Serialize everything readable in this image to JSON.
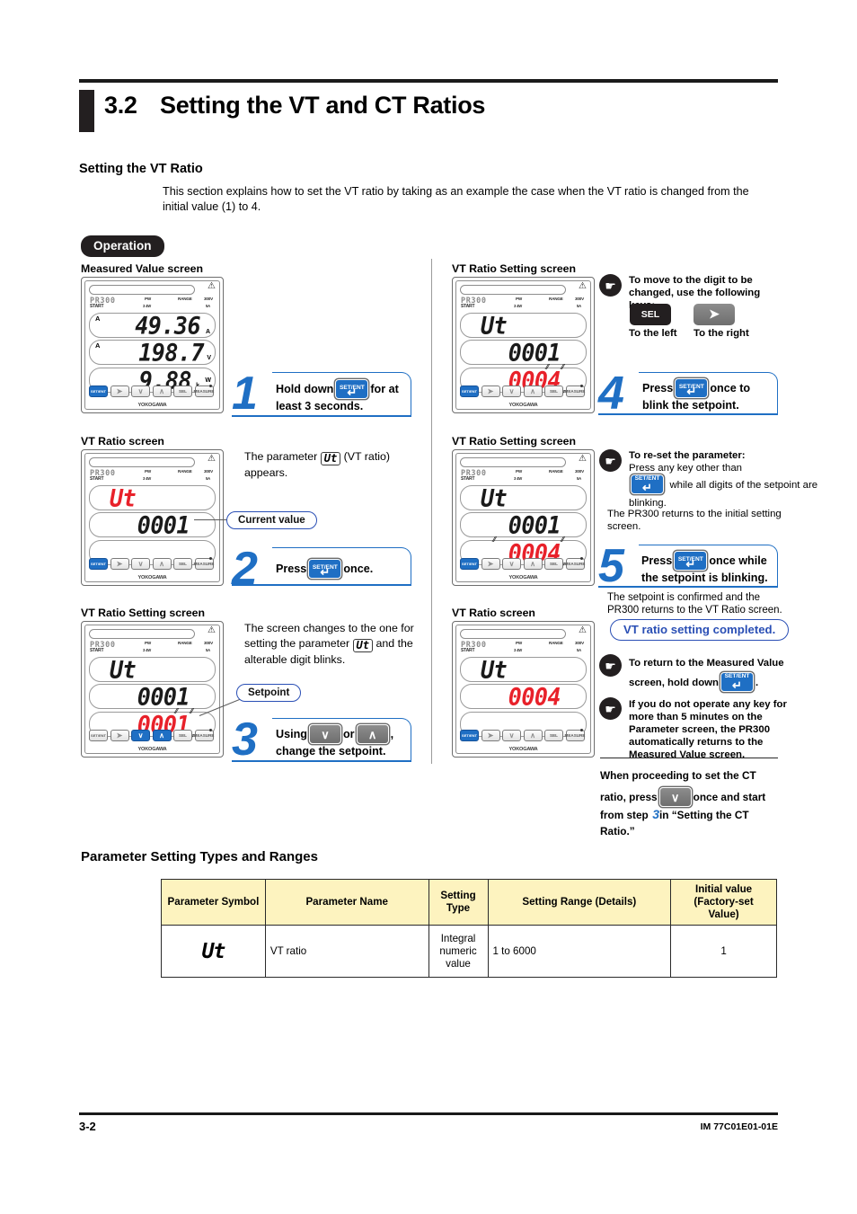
{
  "header": {
    "section_number": "3.2",
    "section_title": "Setting the VT and CT Ratios",
    "subsection_title": "Setting the VT Ratio",
    "intro": "This section explains how to set the VT ratio by taking as an example the case when the VT ratio is changed from the initial value (1) to 4."
  },
  "operation_badge": "Operation",
  "device": {
    "brand": "PR300",
    "yokogawa": "YOKOGAWA",
    "start_label": "START",
    "indicators": {
      "pw": "PW",
      "phase": "3 4W",
      "range": "RANGE",
      "volt": "300V",
      "amp": "5A"
    },
    "keys": {
      "setent": "SET/ENT",
      "right": "▶",
      "down": "∨",
      "up": "∧",
      "sel": "SEL",
      "measure": "MEASURE"
    }
  },
  "panels": {
    "p1": {
      "label": "Measured Value screen",
      "line1": "49.36",
      "line1_unitL": "A",
      "line1_unitR": "A",
      "line2": "198.7",
      "line2_unitL": "A",
      "line2_unitR": "V",
      "line3": "9.88",
      "line3_unitR": "W",
      "line3_k": "k"
    },
    "p2": {
      "label": "VT Ratio screen",
      "line1": "Ut",
      "line2": "0001",
      "line3": ""
    },
    "p3": {
      "label": "VT Ratio Setting screen",
      "line1": "Ut",
      "line2": "0001",
      "line3": "0001"
    },
    "p4": {
      "label": "VT Ratio Setting screen",
      "line1": "Ut",
      "line2": "0001",
      "line3": "0004"
    },
    "p5": {
      "label": "VT Ratio Setting screen",
      "line1": "Ut",
      "line2": "0001",
      "line3": "0004"
    },
    "p6": {
      "label": "VT Ratio screen",
      "line1": "Ut",
      "line2": "0004",
      "line3": ""
    }
  },
  "steps": {
    "s1": {
      "number": "1",
      "text_a": "Hold down",
      "text_b": "for at least 3 seconds."
    },
    "s2": {
      "number": "2",
      "text_a": "Press",
      "text_b": "once."
    },
    "s3": {
      "number": "3",
      "text_a": "Using",
      "text_or": "or",
      "text_b": ", change the setpoint."
    },
    "s4": {
      "number": "4",
      "text_a": "Press",
      "text_b": "once to blink the setpoint."
    },
    "s5": {
      "number": "5",
      "text_a": "Press",
      "text_b": "once while the setpoint is blinking."
    }
  },
  "annotations": {
    "p2_desc_a": "The parameter",
    "p2_desc_sym": "Ut",
    "p2_desc_b": "(VT ratio) appears.",
    "current_value": "Current value",
    "setpoint": "Setpoint",
    "p3_desc_a": "The screen changes to the one for setting the parameter",
    "p3_desc_sym": "Ut",
    "p3_desc_b": "and the alterable digit blinks."
  },
  "notes": {
    "move_digit_title": "To move to the digit to be changed, use the following keys:",
    "sel_key": "SEL",
    "sel_caption": "To the left",
    "right_caption": "To the right",
    "reset_title": "To re-set the parameter:",
    "reset_a": "Press any key other than",
    "reset_b": "while all digits of the setpoint are blinking.",
    "reset_c": "The PR300 returns to the initial setting screen.",
    "confirm_text": "The setpoint is confirmed and the PR300 returns to the VT Ratio screen.",
    "completed_badge": "VT ratio setting completed.",
    "return_a": "To return to the Measured Value",
    "return_b": "screen, hold down",
    "return_c": ".",
    "timeout": "If you do not operate any key for more than 5 minutes on the Parameter screen, the PR300 automatically returns to the Measured Value screen.",
    "ct_a": "When proceeding to set the CT",
    "ct_b": "ratio, press",
    "ct_c": "once and start from step",
    "ct_step": "3",
    "ct_d": "in “Setting the CT Ratio.”"
  },
  "table": {
    "title": "Parameter Setting Types and Ranges",
    "headers": [
      "Parameter Symbol",
      "Parameter Name",
      "Setting Type",
      "Setting Range (Details)",
      "Initial value (Factory-set Value)"
    ],
    "header_lines": {
      "h3_l1": "Setting",
      "h3_l2": "Type",
      "h5_l1": "Initial value",
      "h5_l2": "(Factory-set",
      "h5_l3": "Value)"
    },
    "rows": [
      {
        "symbol": "Ut",
        "name": "VT ratio",
        "type_l1": "Integral",
        "type_l2": "numeric",
        "type_l3": "value",
        "range": "1 to 6000",
        "initial": "1"
      }
    ]
  },
  "footer": {
    "page": "3-2",
    "doc_id": "IM 77C01E01-01E"
  },
  "colors": {
    "accent_blue": "#1f6fc4",
    "lcd_red": "#e8212a",
    "table_header": "#fdf3bf",
    "badge_black": "#231f20"
  }
}
